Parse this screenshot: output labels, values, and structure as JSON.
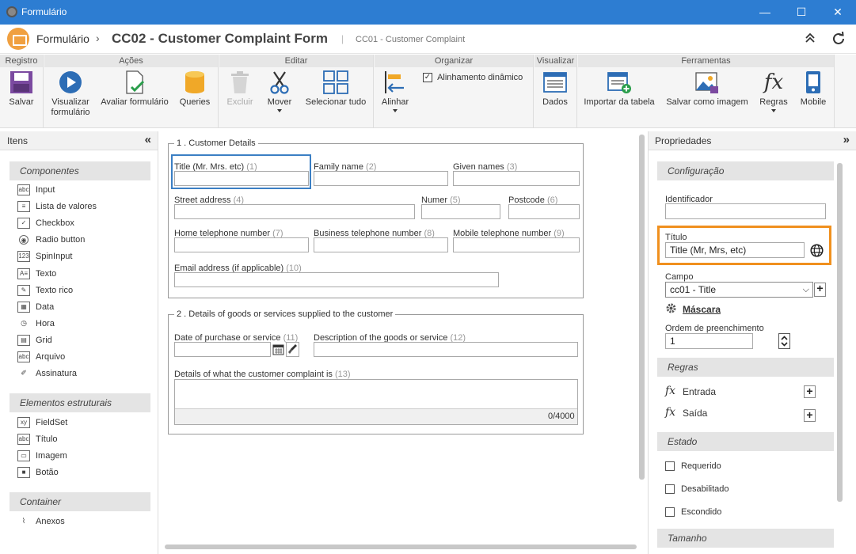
{
  "window": {
    "title": "Formulário",
    "minimize": "—",
    "maximize": "☐",
    "close": "✕"
  },
  "header": {
    "module": "Formulário",
    "separator": "›",
    "form_title": "CC02 - Customer Complaint Form",
    "bar": "|",
    "subtitle": "CC01 - Customer Complaint"
  },
  "ribbon": {
    "groups": {
      "registro": "Registro",
      "acoes": "Ações",
      "editar": "Editar",
      "organizar": "Organizar",
      "visualizar": "Visualizar",
      "ferramentas": "Ferramentas"
    },
    "salvar": "Salvar",
    "visualizar_formulario_1": "Visualizar",
    "visualizar_formulario_2": "formulário",
    "avaliar": "Avaliar formulário",
    "queries": "Queries",
    "excluir": "Excluir",
    "mover": "Mover",
    "selecionar_tudo": "Selecionar tudo",
    "alinhar": "Alinhar",
    "alinhamento_dinamico": "Alinhamento dinâmico",
    "dados": "Dados",
    "importar_tabela": "Importar da tabela",
    "salvar_imagem": "Salvar como imagem",
    "regras": "Regras",
    "mobile": "Mobile"
  },
  "left_panel": {
    "title": "Itens",
    "collapse": "«",
    "componentes": "Componentes",
    "components": [
      {
        "icon": "abc",
        "label": "Input"
      },
      {
        "icon": "≡",
        "label": "Lista de valores"
      },
      {
        "icon": "✓",
        "label": "Checkbox"
      },
      {
        "icon": "◉",
        "label": "Radio button"
      },
      {
        "icon": "123",
        "label": "SpinInput"
      },
      {
        "icon": "A≡",
        "label": "Texto"
      },
      {
        "icon": "✎",
        "label": "Texto rico"
      },
      {
        "icon": "▦",
        "label": "Data"
      },
      {
        "icon": "◷",
        "label": "Hora"
      },
      {
        "icon": "▤",
        "label": "Grid"
      },
      {
        "icon": "abc",
        "label": "Arquivo"
      },
      {
        "icon": "✐",
        "label": "Assinatura"
      }
    ],
    "estruturais": "Elementos estruturais",
    "structural": [
      {
        "icon": "xy",
        "label": "FieldSet"
      },
      {
        "icon": "abc",
        "label": "Título"
      },
      {
        "icon": "▭",
        "label": "Imagem"
      },
      {
        "icon": "■",
        "label": "Botão"
      }
    ],
    "container": "Container",
    "container_items": [
      {
        "icon": "⌇",
        "label": "Anexos"
      }
    ]
  },
  "form": {
    "section1": "1 . Customer Details",
    "title_label": "Title (Mr. Mrs. etc)",
    "title_num": "(1)",
    "family_label": "Family name",
    "family_num": "(2)",
    "given_label": "Given names",
    "given_num": "(3)",
    "street_label": "Street address",
    "street_num": "(4)",
    "numero_label": "Numer",
    "numero_num": "(5)",
    "postcode_label": "Postcode",
    "postcode_num": "(6)",
    "home_label": "Home telephone number",
    "home_num": "(7)",
    "business_label": "Business telephone number",
    "business_num": "(8)",
    "mobile_label": "Mobile telephone number",
    "mobile_num": "(9)",
    "email_label": "Email address (if applicable)",
    "email_num": "(10)",
    "section2": "2 . Details of goods or services supplied to the customer",
    "date_label": "Date of purchase or service",
    "date_num": "(11)",
    "desc_label": "Description of the goods or service",
    "desc_num": "(12)",
    "details_label": "Details of what the customer complaint is",
    "details_num": "(13)",
    "counter": "0/4000"
  },
  "right_panel": {
    "title": "Propriedades",
    "collapse": "»",
    "configuracao": "Configuração",
    "identificador_label": "Identificador",
    "identificador_value": "",
    "titulo_label": "Título",
    "titulo_value": "Title (Mr, Mrs, etc)",
    "campo_label": "Campo",
    "campo_value": "cc01 - Title",
    "mascara": "Máscara",
    "ordem_label": "Ordem de preenchimento",
    "ordem_value": "1",
    "regras": "Regras",
    "entrada": "Entrada",
    "saida": "Saída",
    "estado": "Estado",
    "requerido": "Requerido",
    "desabilitado": "Desabilitado",
    "escondido": "Escondido",
    "tamanho": "Tamanho",
    "plus": "+"
  },
  "colors": {
    "titlebar": "#2d7dd2",
    "highlight_orange": "#f0901e",
    "selected_blue": "#3b7fc4",
    "accent": "#2d6db5"
  }
}
